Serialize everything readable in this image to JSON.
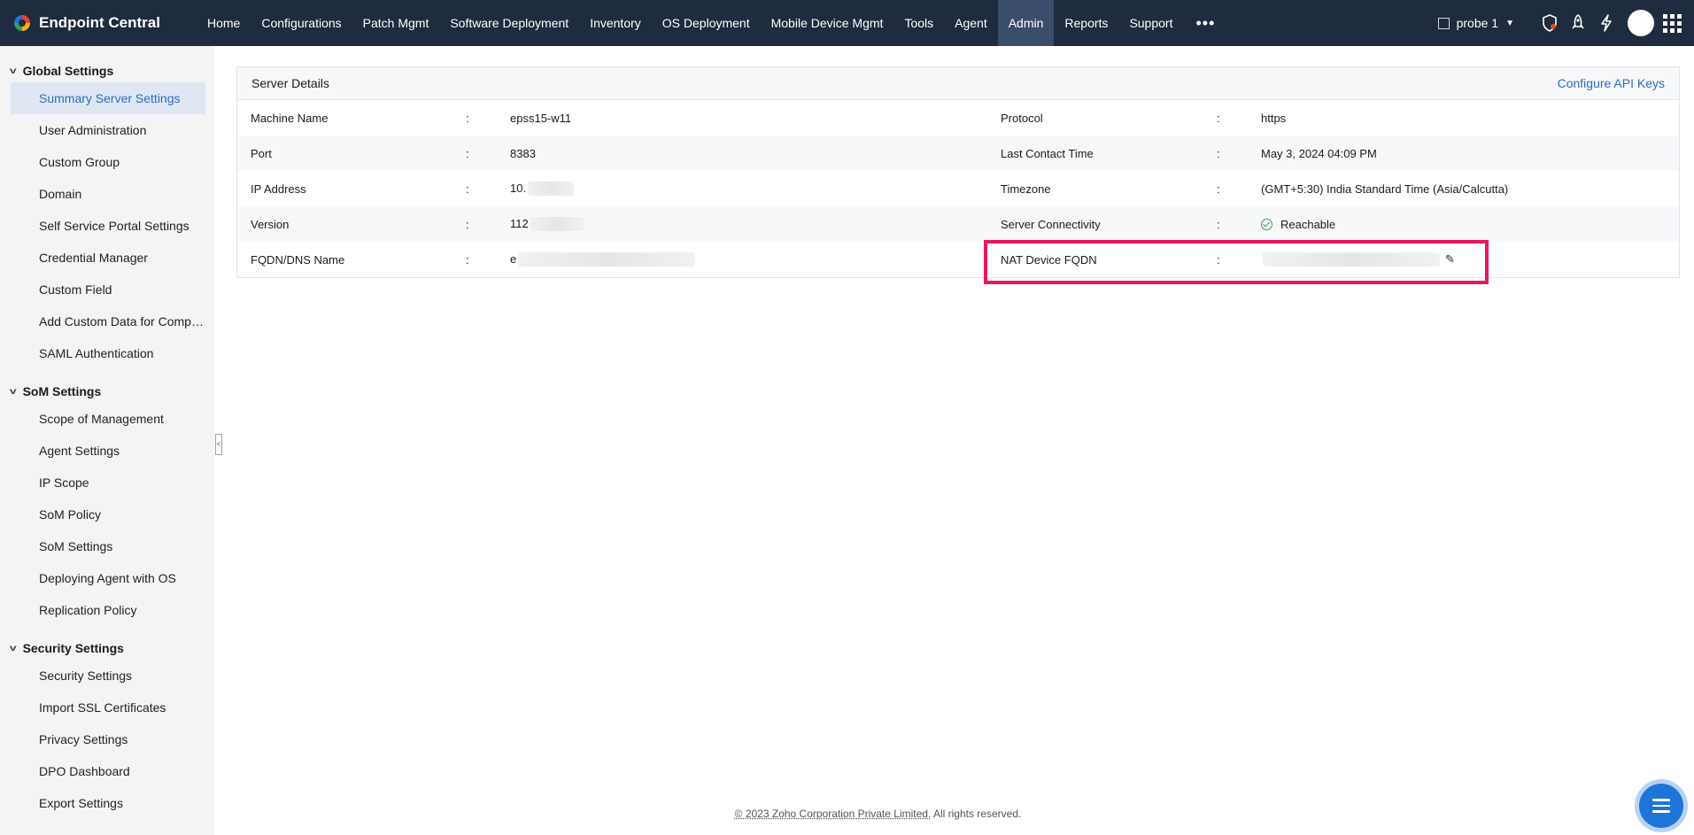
{
  "app": {
    "name": "Endpoint Central"
  },
  "nav": {
    "items": [
      "Home",
      "Configurations",
      "Patch Mgmt",
      "Software Deployment",
      "Inventory",
      "OS Deployment",
      "Mobile Device Mgmt",
      "Tools",
      "Agent",
      "Admin",
      "Reports",
      "Support"
    ],
    "active": "Admin",
    "more": "•••"
  },
  "topright": {
    "probe_label": "probe 1",
    "icons": [
      "shield-icon",
      "rocket-icon",
      "lightning-icon",
      "avatar",
      "apps-grid-icon"
    ]
  },
  "sidebar": {
    "groups": [
      {
        "title": "Global Settings",
        "items": [
          "Summary Server Settings",
          "User Administration",
          "Custom Group",
          "Domain",
          "Self Service Portal Settings",
          "Credential Manager",
          "Custom Field",
          "Add Custom Data for Comput...",
          "SAML Authentication"
        ]
      },
      {
        "title": "SoM Settings",
        "items": [
          "Scope of Management",
          "Agent Settings",
          "IP Scope",
          "SoM Policy",
          "SoM Settings",
          "Deploying Agent with OS",
          "Replication Policy"
        ]
      },
      {
        "title": "Security Settings",
        "items": [
          "Security Settings",
          "Import SSL Certificates",
          "Privacy Settings",
          "DPO Dashboard",
          "Export Settings"
        ]
      }
    ],
    "active_item": "Summary Server Settings"
  },
  "panel": {
    "title": "Server Details",
    "link": "Configure API Keys",
    "separator": ":",
    "rows": [
      {
        "left_label": "Machine Name",
        "left_value": "epss15-w11",
        "right_label": "Protocol",
        "right_value": "https"
      },
      {
        "left_label": "Port",
        "left_value": "8383",
        "right_label": "Last Contact Time",
        "right_value": "May 3, 2024 04:09 PM"
      },
      {
        "left_label": "IP Address",
        "left_value": "10.",
        "right_label": "Timezone",
        "right_value": "(GMT+5:30) India Standard Time (Asia/Calcutta)"
      },
      {
        "left_label": "Version",
        "left_value": "112",
        "right_label": "Server Connectivity",
        "right_value": "Reachable"
      },
      {
        "left_label": "FQDN/DNS Name",
        "left_value": "e",
        "right_label": "NAT Device FQDN",
        "right_value": ""
      }
    ]
  },
  "colors": {
    "nav_bg": "#1f2b3e",
    "accent": "#2a6cc4",
    "highlight": "#e8175d",
    "ok": "#2e9e4f"
  },
  "footer": {
    "text": "© 2023 Zoho Corporation Private Limited.",
    "rights": "All rights reserved."
  }
}
